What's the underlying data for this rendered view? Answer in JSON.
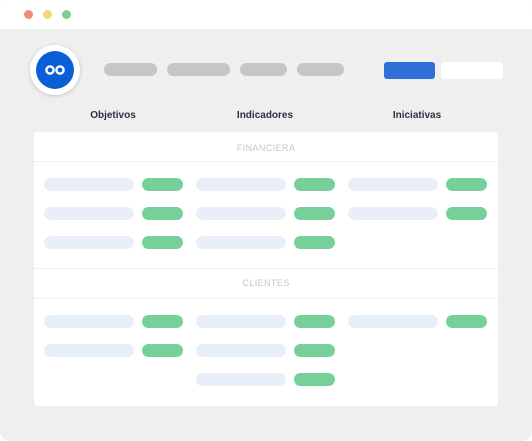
{
  "window": {
    "controls": [
      {
        "name": "close",
        "color": "#f08a7d"
      },
      {
        "name": "minimize",
        "color": "#f6d67a"
      },
      {
        "name": "maximize",
        "color": "#7fd08a"
      }
    ]
  },
  "header": {
    "logo_icon": "infinity-icon",
    "logo_color": "#0b5fd6",
    "nav_items": 4,
    "primary_button_color": "#2f6fd8",
    "secondary_button_color": "#ffffff"
  },
  "columns": [
    "Objetivos",
    "Indicadores",
    "Iniciativas"
  ],
  "sections": [
    {
      "title": "FINANCIERA",
      "rows": [
        [
          true,
          true,
          true
        ],
        [
          true,
          true,
          true
        ],
        [
          true,
          true,
          false
        ]
      ]
    },
    {
      "title": "CLIENTES",
      "rows": [
        [
          true,
          true,
          true
        ],
        [
          true,
          true,
          false
        ],
        [
          false,
          true,
          false
        ]
      ]
    }
  ],
  "colors": {
    "placeholder": "#e9eff9",
    "status": "#77d09a",
    "nav_pill": "#c6c6c6"
  }
}
